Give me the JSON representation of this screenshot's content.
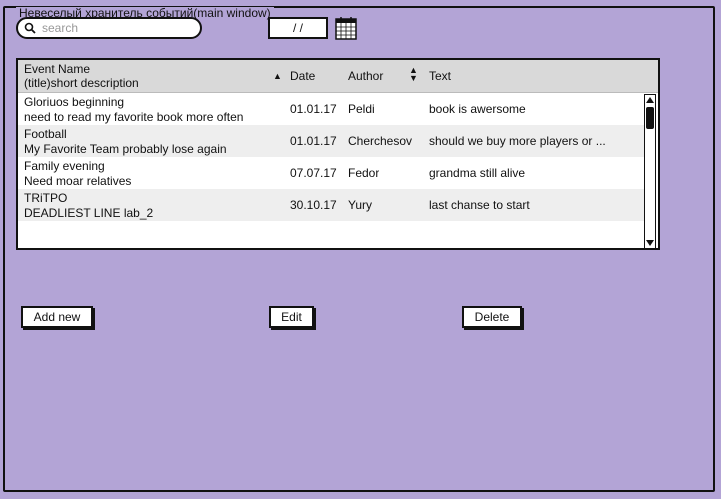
{
  "window": {
    "title": "Невеселый хранитель событий(main window)"
  },
  "search": {
    "placeholder": "search",
    "value": ""
  },
  "date_filter": {
    "value": "/ /"
  },
  "table": {
    "headers": {
      "name_line1": "Event Name",
      "name_line2": "(title)short description",
      "date": "Date",
      "author": "Author",
      "text": "Text"
    },
    "rows": [
      {
        "title": "Gloriuos beginning",
        "desc": "need to read my favorite book more often",
        "date": "01.01.17",
        "author": "Peldi",
        "text": "book is awersome"
      },
      {
        "title": "Football",
        "desc": "My Favorite Team probably lose again",
        "date": "01.01.17",
        "author": "Cherchesov",
        "text": "should we buy more players or ..."
      },
      {
        "title": "Family evening",
        "desc": "Need moar relatives",
        "date": "07.07.17",
        "author": "Fedor",
        "text": "grandma still alive"
      },
      {
        "title": "TRiTPO",
        "desc": "DEADLIEST LINE lab_2",
        "date": "30.10.17",
        "author": "Yury",
        "text": "last chanse to start"
      }
    ]
  },
  "buttons": {
    "add": "Add new",
    "edit": "Edit",
    "delete": "Delete"
  },
  "icons": {
    "search": "search-icon",
    "calendar": "calendar-icon",
    "sort": "sort-arrow-icon"
  }
}
